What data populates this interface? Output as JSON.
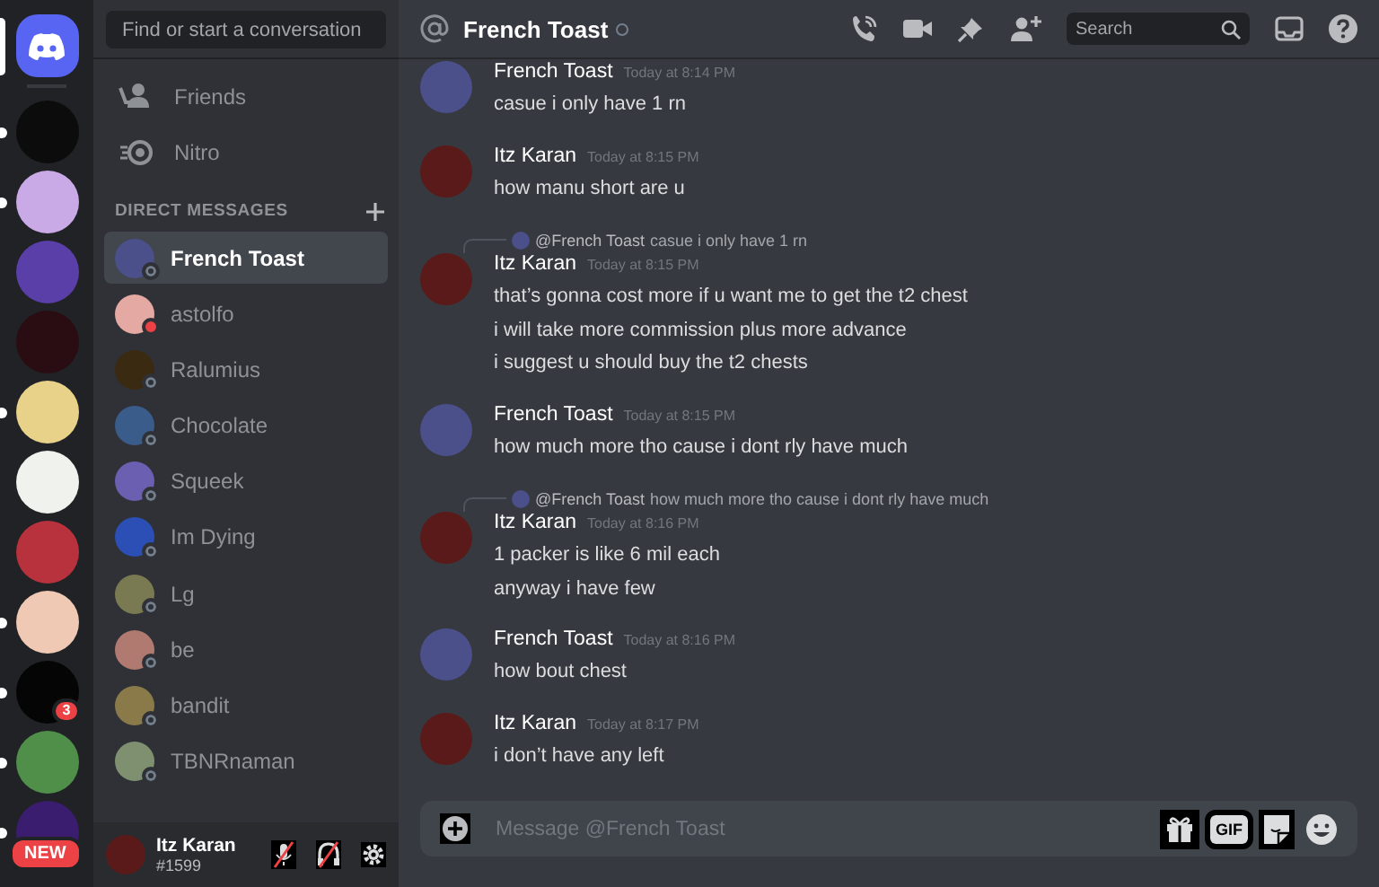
{
  "servers": [
    {
      "kind": "home",
      "selected": true,
      "unread": false,
      "color": "#5865f2"
    },
    {
      "kind": "avatar",
      "selected": false,
      "unread": true,
      "color": "#0c0c0c"
    },
    {
      "kind": "avatar",
      "selected": false,
      "unread": true,
      "color": "#c9a9e6"
    },
    {
      "kind": "avatar",
      "selected": false,
      "unread": false,
      "color": "#5b3fa8"
    },
    {
      "kind": "avatar",
      "selected": false,
      "unread": false,
      "color": "#2a0d12"
    },
    {
      "kind": "avatar",
      "selected": false,
      "unread": true,
      "color": "#e8d28a"
    },
    {
      "kind": "avatar",
      "selected": false,
      "unread": false,
      "color": "#f0f2ee"
    },
    {
      "kind": "avatar",
      "selected": false,
      "unread": false,
      "color": "#b8323e"
    },
    {
      "kind": "avatar",
      "selected": false,
      "unread": true,
      "color": "#efc9b4"
    },
    {
      "kind": "avatar",
      "selected": false,
      "unread": true,
      "color": "#050505",
      "badge": "3"
    },
    {
      "kind": "avatar",
      "selected": false,
      "unread": true,
      "color": "#4f8f4a"
    },
    {
      "kind": "avatar",
      "selected": false,
      "unread": true,
      "color": "#3a1d6e",
      "label": "NEW"
    }
  ],
  "search": {
    "placeholder": "Find or start a conversation"
  },
  "nav": [
    {
      "kind": "friends",
      "label": "Friends"
    },
    {
      "kind": "nitro",
      "label": "Nitro"
    }
  ],
  "dm_header": "DIRECT MESSAGES",
  "dms": [
    {
      "name": "French Toast",
      "selected": true,
      "color": "#4b4f8a",
      "do_not_disturb": false
    },
    {
      "name": "astolfo",
      "selected": false,
      "color": "#e3a9a2",
      "do_not_disturb": true
    },
    {
      "name": "Ralumius",
      "selected": false,
      "color": "#3a2a12",
      "do_not_disturb": false
    },
    {
      "name": "Chocolate",
      "selected": false,
      "color": "#3a5c8a",
      "do_not_disturb": false
    },
    {
      "name": "Squeek",
      "selected": false,
      "color": "#6a5fb0",
      "do_not_disturb": false
    },
    {
      "name": "Im Dying",
      "selected": false,
      "color": "#2b4fb5",
      "do_not_disturb": false
    },
    {
      "name": "Lg",
      "selected": false,
      "color": "#7a7a52",
      "do_not_disturb": false
    },
    {
      "name": "be",
      "selected": false,
      "color": "#b07a70",
      "do_not_disturb": false
    },
    {
      "name": "bandit",
      "selected": false,
      "color": "#8a7a4a",
      "do_not_disturb": false
    },
    {
      "name": "TBNRnaman",
      "selected": false,
      "color": "#7f9070",
      "do_not_disturb": false
    }
  ],
  "user": {
    "name": "Itz Karan",
    "tag": "#1599",
    "color": "#5a1a1a"
  },
  "channel": {
    "name": "French Toast",
    "search_placeholder": "Search"
  },
  "messages": [
    {
      "author": "French Toast",
      "time": "Today at 8:14 PM",
      "color": "#4b4f8a",
      "lines": [
        "casue i only have 1 rn"
      ]
    },
    {
      "author": "Itz Karan",
      "time": "Today at 8:15 PM",
      "color": "#5a1a1a",
      "lines": [
        "how manu short are u"
      ]
    },
    {
      "author": "Itz Karan",
      "time": "Today at 8:15 PM",
      "color": "#5a1a1a",
      "reply": {
        "mention": "@French Toast",
        "text": "casue i only have 1 rn"
      },
      "lines": [
        "that’s gonna cost more if u want me to get the t2 chest",
        "i will take more commission plus more advance",
        "i suggest u should buy the t2 chests"
      ]
    },
    {
      "author": "French Toast",
      "time": "Today at 8:15 PM",
      "color": "#4b4f8a",
      "lines": [
        "how much more tho cause i dont rly have much"
      ]
    },
    {
      "author": "Itz Karan",
      "time": "Today at 8:16 PM",
      "color": "#5a1a1a",
      "reply": {
        "mention": "@French Toast",
        "text": "how much more tho cause i dont rly have much"
      },
      "lines": [
        "1 packer is like 6 mil each",
        "anyway i have few"
      ]
    },
    {
      "author": "French Toast",
      "time": "Today at 8:16 PM",
      "color": "#4b4f8a",
      "lines": [
        "how bout chest"
      ]
    },
    {
      "author": "Itz Karan",
      "time": "Today at 8:17 PM",
      "color": "#5a1a1a",
      "lines": [
        "i don’t have any left"
      ]
    }
  ],
  "composer": {
    "placeholder": "Message @French Toast",
    "gif": "GIF"
  }
}
